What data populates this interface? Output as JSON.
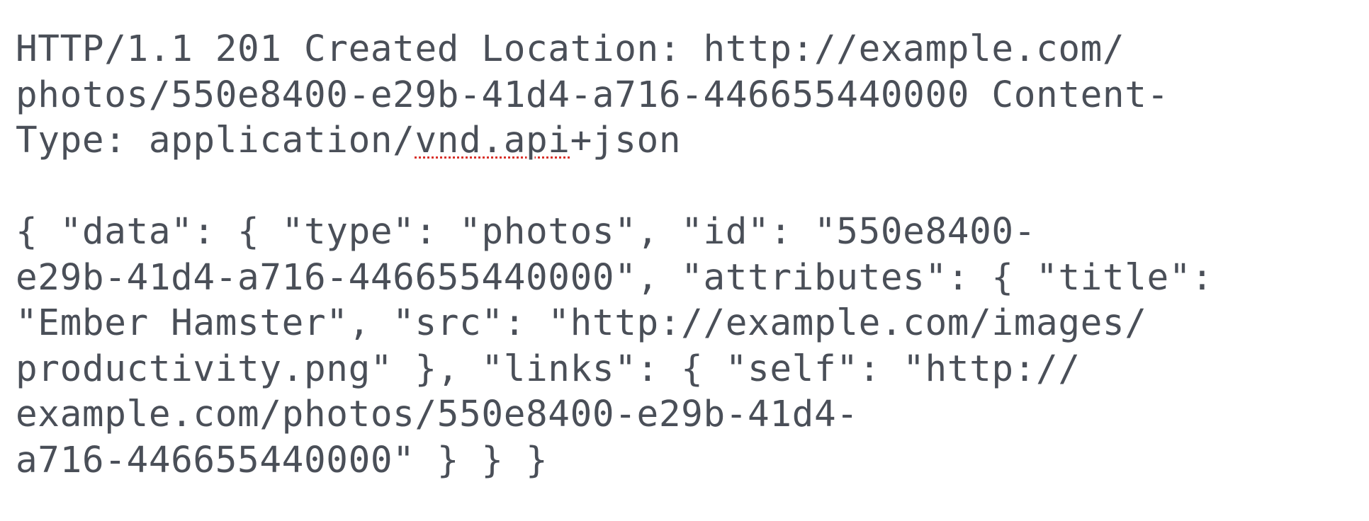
{
  "response_headers": {
    "lines": [
      [
        "HTTP/1.1 201 Created Location: http://example.com/"
      ],
      [
        "photos/550e8400-e29b-41d4-a716-446655440000 Content-"
      ],
      [
        "Type: application/",
        "vnd.api",
        "+json"
      ]
    ]
  },
  "response_body": {
    "lines": [
      "{ \"data\": { \"type\": \"photos\", \"id\": \"550e8400-",
      "e29b-41d4-a716-446655440000\", \"attributes\": { \"title\":",
      "\"Ember Hamster\", \"src\": \"http://example.com/images/",
      "productivity.png\" }, \"links\": { \"self\": \"http://",
      "example.com/photos/550e8400-e29b-41d4-",
      "a716-446655440000\" } } }"
    ]
  },
  "colors": {
    "text": "#4a4f58",
    "spellcheck_underline": "#d9312a",
    "background": "#ffffff"
  }
}
